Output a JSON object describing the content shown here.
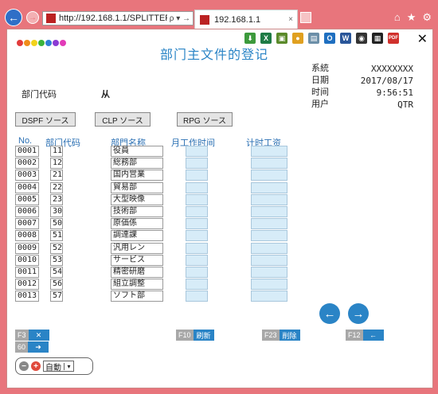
{
  "browser": {
    "url": "http://192.168.1.1/SPLITTER.I",
    "url_controls": "ρ ▾ →",
    "tab_title": "192.168.1.1",
    "back_glyph": "←",
    "forward_glyph": "→",
    "tab_close_glyph": "×",
    "window_icons": {
      "home": "⌂",
      "star": "★",
      "gear": "⚙"
    }
  },
  "toolbar": {
    "icons": [
      {
        "name": "download-icon",
        "glyph": "⬇",
        "color": "#3c9a3c"
      },
      {
        "name": "excel-icon",
        "glyph": "X",
        "color": "#1e7b45"
      },
      {
        "name": "image-icon",
        "glyph": "▣",
        "color": "#5a8a2a"
      },
      {
        "name": "palette-icon",
        "glyph": "●",
        "color": "#e0a020"
      },
      {
        "name": "document-icon",
        "glyph": "▤",
        "color": "#6c8fa8"
      },
      {
        "name": "outlook-icon",
        "glyph": "O",
        "color": "#1f6fc0"
      },
      {
        "name": "word-icon",
        "glyph": "W",
        "color": "#2a5699"
      },
      {
        "name": "camera-icon",
        "glyph": "◉",
        "color": "#333333"
      },
      {
        "name": "printer-icon",
        "glyph": "▦",
        "color": "#222222"
      },
      {
        "name": "pdf-icon",
        "glyph": "PDF",
        "color": "#d0312d"
      }
    ],
    "close_glyph": "✕"
  },
  "logo_colors": [
    "#e23b3b",
    "#f08c1a",
    "#f2d21c",
    "#3bb43b",
    "#2f7fd4",
    "#8b3bd4",
    "#e23bb8"
  ],
  "page_title": "部门主文件的登记",
  "system_info": [
    {
      "key": "系統",
      "value": "XXXXXXXX"
    },
    {
      "key": "日期",
      "value": "2017/08/17"
    },
    {
      "key": "时间",
      "value": "9:56:51"
    },
    {
      "key": "用户",
      "value": "QTR"
    }
  ],
  "dept_code_label": "部门代码",
  "dept_code_value": "从",
  "source_buttons": [
    "DSPF ソース",
    "CLP ソース",
    "RPG ソース"
  ],
  "columns": {
    "no": "No.",
    "code": "部门代码",
    "name": "部門名称",
    "monthly": "月工作时间",
    "hourly": "计时工资"
  },
  "rows": [
    {
      "no": "0001",
      "code": "11",
      "name": "役員"
    },
    {
      "no": "0002",
      "code": "12",
      "name": "総務部"
    },
    {
      "no": "0003",
      "code": "21",
      "name": "国内営業"
    },
    {
      "no": "0004",
      "code": "22",
      "name": "貿易部"
    },
    {
      "no": "0005",
      "code": "23",
      "name": "大型映像"
    },
    {
      "no": "0006",
      "code": "30",
      "name": "技術部"
    },
    {
      "no": "0007",
      "code": "50",
      "name": "原価係"
    },
    {
      "no": "0008",
      "code": "51",
      "name": "調達課"
    },
    {
      "no": "0009",
      "code": "52",
      "name": "汎用レン"
    },
    {
      "no": "0010",
      "code": "53",
      "name": "サービス"
    },
    {
      "no": "0011",
      "code": "54",
      "name": "精密研磨"
    },
    {
      "no": "0012",
      "code": "56",
      "name": "組立調整"
    },
    {
      "no": "0013",
      "code": "57",
      "name": "ソフト部"
    }
  ],
  "paging": {
    "prev_glyph": "←",
    "next_glyph": "→"
  },
  "fkeys": {
    "f3": {
      "key": "F3",
      "glyph": "✕"
    },
    "f60": {
      "key": "60",
      "glyph": "➜"
    },
    "f10": {
      "key": "F10",
      "label": "刷新"
    },
    "f23": {
      "key": "F23",
      "label": "削除"
    },
    "f12": {
      "key": "F12",
      "glyph": "←"
    }
  },
  "auto_mode": {
    "minus": "−",
    "plus": "+",
    "value": "自動",
    "dropdown_glyph": "▾"
  }
}
